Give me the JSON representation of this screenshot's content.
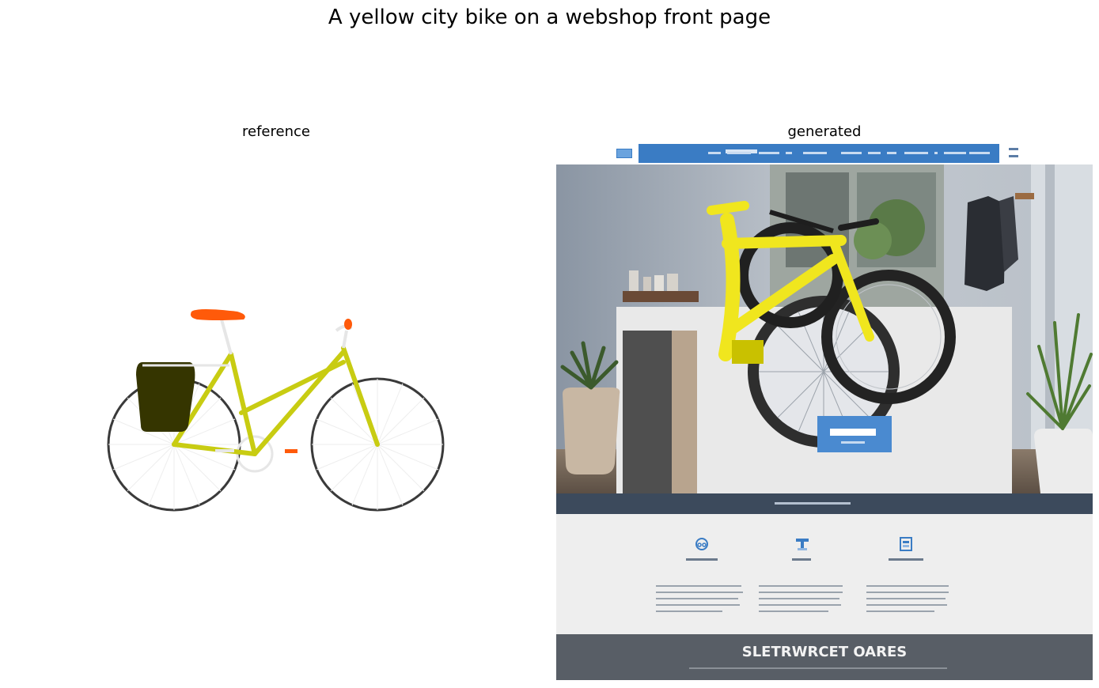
{
  "figure": {
    "title": "A yellow city bike on a webshop front page"
  },
  "panels": {
    "reference": {
      "title": "reference"
    },
    "generated": {
      "title": "generated",
      "footer_heading": "SLETRWRCET OARES"
    }
  },
  "colors": {
    "bike_frame": "#c8cc12",
    "saddle": "#ff5a0a",
    "pannier_bag": "#353500",
    "tire": "#3a3a3a",
    "nav_blue": "#3a7cc4",
    "hero_bike_yellow": "#f0e61e",
    "band_dark": "#3c4a5c",
    "footer_gray": "#585e66"
  }
}
